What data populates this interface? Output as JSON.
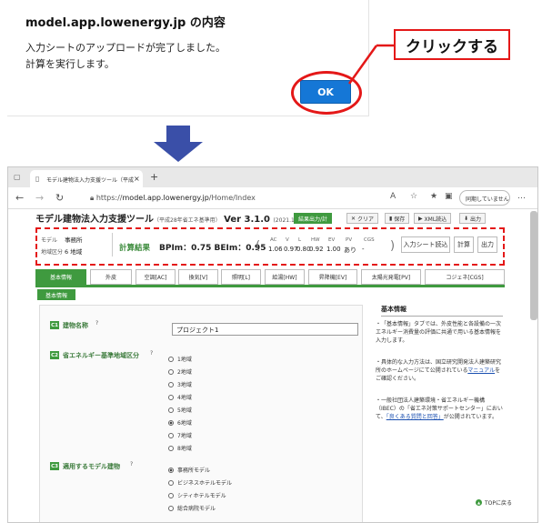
{
  "dialog": {
    "title": "model.app.lowenergy.jp の内容",
    "message_line1": "入力シートのアップロードが完了しました。",
    "message_line2": "計算を実行します。",
    "ok_label": "OK"
  },
  "annotation": {
    "callout": "クリックする",
    "color": "#e41818"
  },
  "arrow": {
    "color": "#3a4fa8"
  },
  "browser": {
    "tab_title": "モデル建物法入力支援ツール（平成",
    "tab_close": "×",
    "new_tab": "+",
    "url_prefix": "https://",
    "url_host": "model.app.lowenergy.jp",
    "url_path": "/Home/Index",
    "profile_label": "同期していません"
  },
  "app": {
    "title": "モデル建物法入力支援ツール",
    "title_sub": "（平成28年省エネ基準用）",
    "version": "Ver 3.1.0",
    "version_date": "(2021.10)",
    "toolbar": {
      "calc": "結果出力/計",
      "clear": "クリア",
      "save": "保存",
      "xml": "XML読込",
      "output": "出力"
    },
    "summary": {
      "model_label": "モデル",
      "model_value": "事務所",
      "region_label": "地域区分",
      "region_value": "6 地域",
      "calc_label": "計算結果",
      "calc_text": "BPIm：0.75  BEIm：0.95",
      "headers": [
        "AC",
        "V",
        "L",
        "HW",
        "EV",
        "PV",
        "CGS"
      ],
      "values": [
        "1.06",
        "0.97",
        "0.80",
        "0.92",
        "1.00",
        "あり",
        "-"
      ],
      "btn_upload": "入力シート読込",
      "btn_calc": "計算",
      "btn_out": "出力"
    },
    "category_tabs": [
      "基本情報",
      "外皮",
      "空調[AC]",
      "換気[V]",
      "照明[L]",
      "給湯[HW]",
      "昇降機[EV]",
      "太陽光発電[PV]",
      "コジェネ[CGS]"
    ],
    "sub_tab": "基本情報",
    "form": {
      "q1_num": "C1",
      "q1_label": "建物名称",
      "q1_help": "?",
      "q1_value": "プロジェクト1",
      "q2_num": "C2",
      "q2_label": "省エネルギー基準地域区分",
      "q2_help": "?",
      "q2_options": [
        "1地域",
        "2地域",
        "3地域",
        "4地域",
        "5地域",
        "6地域",
        "7地域",
        "8地域"
      ],
      "q2_selected": "6地域",
      "q3_num": "C3",
      "q3_label": "適用するモデル建物",
      "q3_help": "?",
      "q3_options": [
        "事務所モデル",
        "ビジネスホテルモデル",
        "シティホテルモデル",
        "総合病院モデル"
      ],
      "q3_selected": "事務所モデル"
    },
    "info": {
      "title": "基本情報",
      "p1": "「基本情報」タブでは、外皮性能と各設備の一次エネルギー消費量の評価に共通で用いる基本情報を入力します。",
      "p2_a": "具体的な入力方法は、国立研究開発法人建築研究所のホームページにて公開されている",
      "p2_link": "マニュアル",
      "p2_b": "をご確認ください。",
      "p3_a": "一般社団法人建築環境・省エネルギー機構（IBEC）の「省エネ対策サポートセンター」において、",
      "p3_link": "「良くある質問と回答」",
      "p3_b": "が公開されています。"
    },
    "to_top": "TOPに戻る",
    "accent_color": "#3f9a3f"
  }
}
